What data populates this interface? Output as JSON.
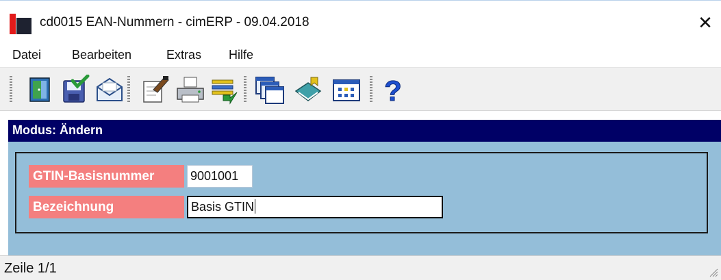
{
  "window": {
    "title": "cd0015 EAN-Nummern - cimERP - 09.04.2018",
    "close_glyph": "✕"
  },
  "menu": {
    "items": [
      {
        "label": "Datei"
      },
      {
        "label": "Bearbeiten"
      },
      {
        "label": "Extras"
      },
      {
        "label": "Hilfe"
      }
    ]
  },
  "toolbar": {
    "buttons": [
      {
        "icon": "exit-door-icon"
      },
      {
        "icon": "save-icon"
      },
      {
        "icon": "mail-icon"
      },
      {
        "icon": "edit-notes-icon"
      },
      {
        "icon": "print-icon"
      },
      {
        "icon": "transfer-icon"
      },
      {
        "icon": "windows-icon"
      },
      {
        "icon": "book-icon"
      },
      {
        "icon": "calendar-icon"
      },
      {
        "icon": "help-icon"
      }
    ]
  },
  "mode": {
    "text": "Modus: Ändern"
  },
  "form": {
    "gtin_label": "GTIN-Basisnummer",
    "gtin_value": "9001001",
    "bezeichnung_label": "Bezeichnung",
    "bezeichnung_value": "Basis GTIN"
  },
  "status": {
    "text": "Zeile 1/1"
  },
  "colors": {
    "mode_bar": "#000066",
    "form_background": "#94bed9",
    "label_background": "#f47f7f",
    "accent_red": "#e21b1b"
  }
}
